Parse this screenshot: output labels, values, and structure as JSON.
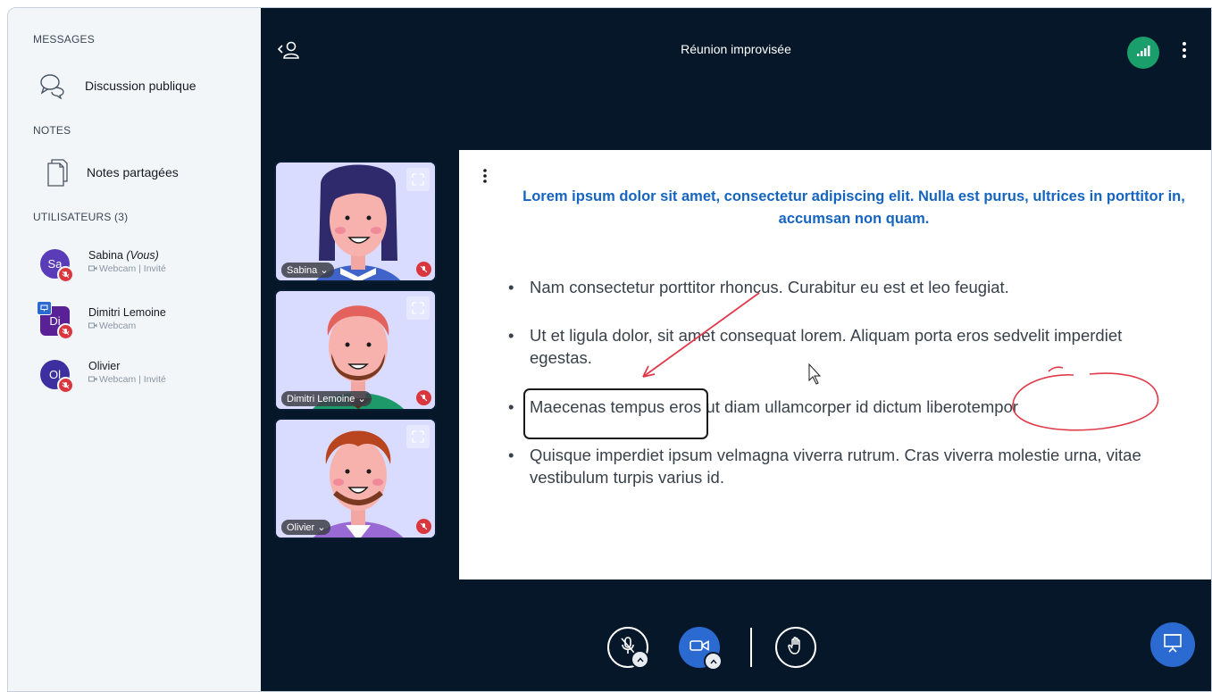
{
  "sidebar": {
    "messages_title": "MESSAGES",
    "public_chat": "Discussion publique",
    "notes_title": "NOTES",
    "shared_notes": "Notes partagées",
    "users_title": "UTILISATEURS (3)",
    "users": [
      {
        "initials": "Sa",
        "name": "Sabina",
        "you": "(Vous)",
        "status": "Webcam | Invité",
        "color": "#5a3bb8"
      },
      {
        "initials": "Di",
        "name": "Dimitri Lemoine",
        "you": "",
        "status": "Webcam",
        "color": "#5a2096"
      },
      {
        "initials": "Ol",
        "name": "Olivier",
        "you": "",
        "status": "Webcam | Invité",
        "color": "#3d2fa0"
      }
    ]
  },
  "header": {
    "title": "Réunion improvisée"
  },
  "videos": [
    {
      "name": "Sabina"
    },
    {
      "name": "Dimitri Lemoine"
    },
    {
      "name": "Olivier"
    }
  ],
  "slide": {
    "title": "Lorem ipsum dolor sit amet, consectetur adipiscing elit. Nulla est purus, ultrices in porttitor in, accumsan non quam.",
    "bullets": [
      "Nam consectetur porttitor rhoncus. Curabitur eu est et leo feugiat.",
      "Ut et ligula dolor, sit amet consequat lorem. Aliquam porta eros sedvelit imperdiet egestas.",
      "Maecenas tempus eros ut diam ullamcorper id dictum liberotempor",
      "Quisque imperdiet ipsum velmagna viverra rutrum. Cras viverra molestie urna, vitae vestibulum turpis varius id."
    ]
  },
  "icons": {
    "chat": "chat-bubbles-icon",
    "notes": "notes-icon",
    "mic": "mic-off-icon",
    "camera": "camera-icon",
    "hand": "raise-hand-icon",
    "presentation": "presentation-icon"
  },
  "colors": {
    "background": "#06172a",
    "sidebar": "#f3f6f9",
    "accent": "#2b6ad1",
    "connection": "#1a9e6b",
    "title_blue": "#1565c0",
    "mute_red": "#d9363e"
  }
}
